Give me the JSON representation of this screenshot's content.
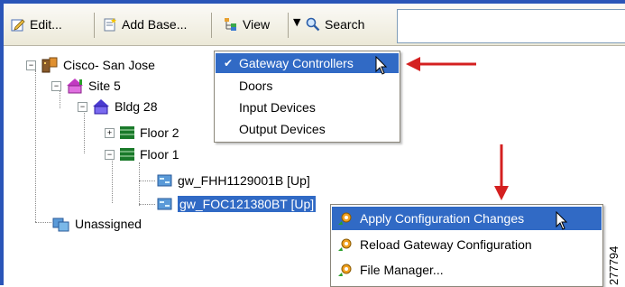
{
  "toolbar": {
    "edit_label": "Edit...",
    "add_base_label": "Add Base...",
    "view_label": "View",
    "search_label": "Search"
  },
  "tree": {
    "root": "Cisco- San Jose",
    "site": "Site 5",
    "building": "Bldg 28",
    "floor2": "Floor 2",
    "floor1": "Floor 1",
    "gw1": "gw_FHH1129001B [Up]",
    "gw2": "gw_FOC121380BT [Up]",
    "unassigned": "Unassigned"
  },
  "view_menu": {
    "items": [
      {
        "label": "Gateway Controllers",
        "checked": true
      },
      {
        "label": "Doors"
      },
      {
        "label": "Input Devices"
      },
      {
        "label": "Output Devices"
      }
    ]
  },
  "context_menu": {
    "items": [
      {
        "label": "Apply Configuration Changes"
      },
      {
        "label": "Reload Gateway Configuration"
      },
      {
        "label": "File Manager..."
      }
    ]
  },
  "figure_number": "277794",
  "colors": {
    "selection": "#316ac5",
    "frame": "#2a55b8",
    "callout_arrow": "#d42020"
  }
}
